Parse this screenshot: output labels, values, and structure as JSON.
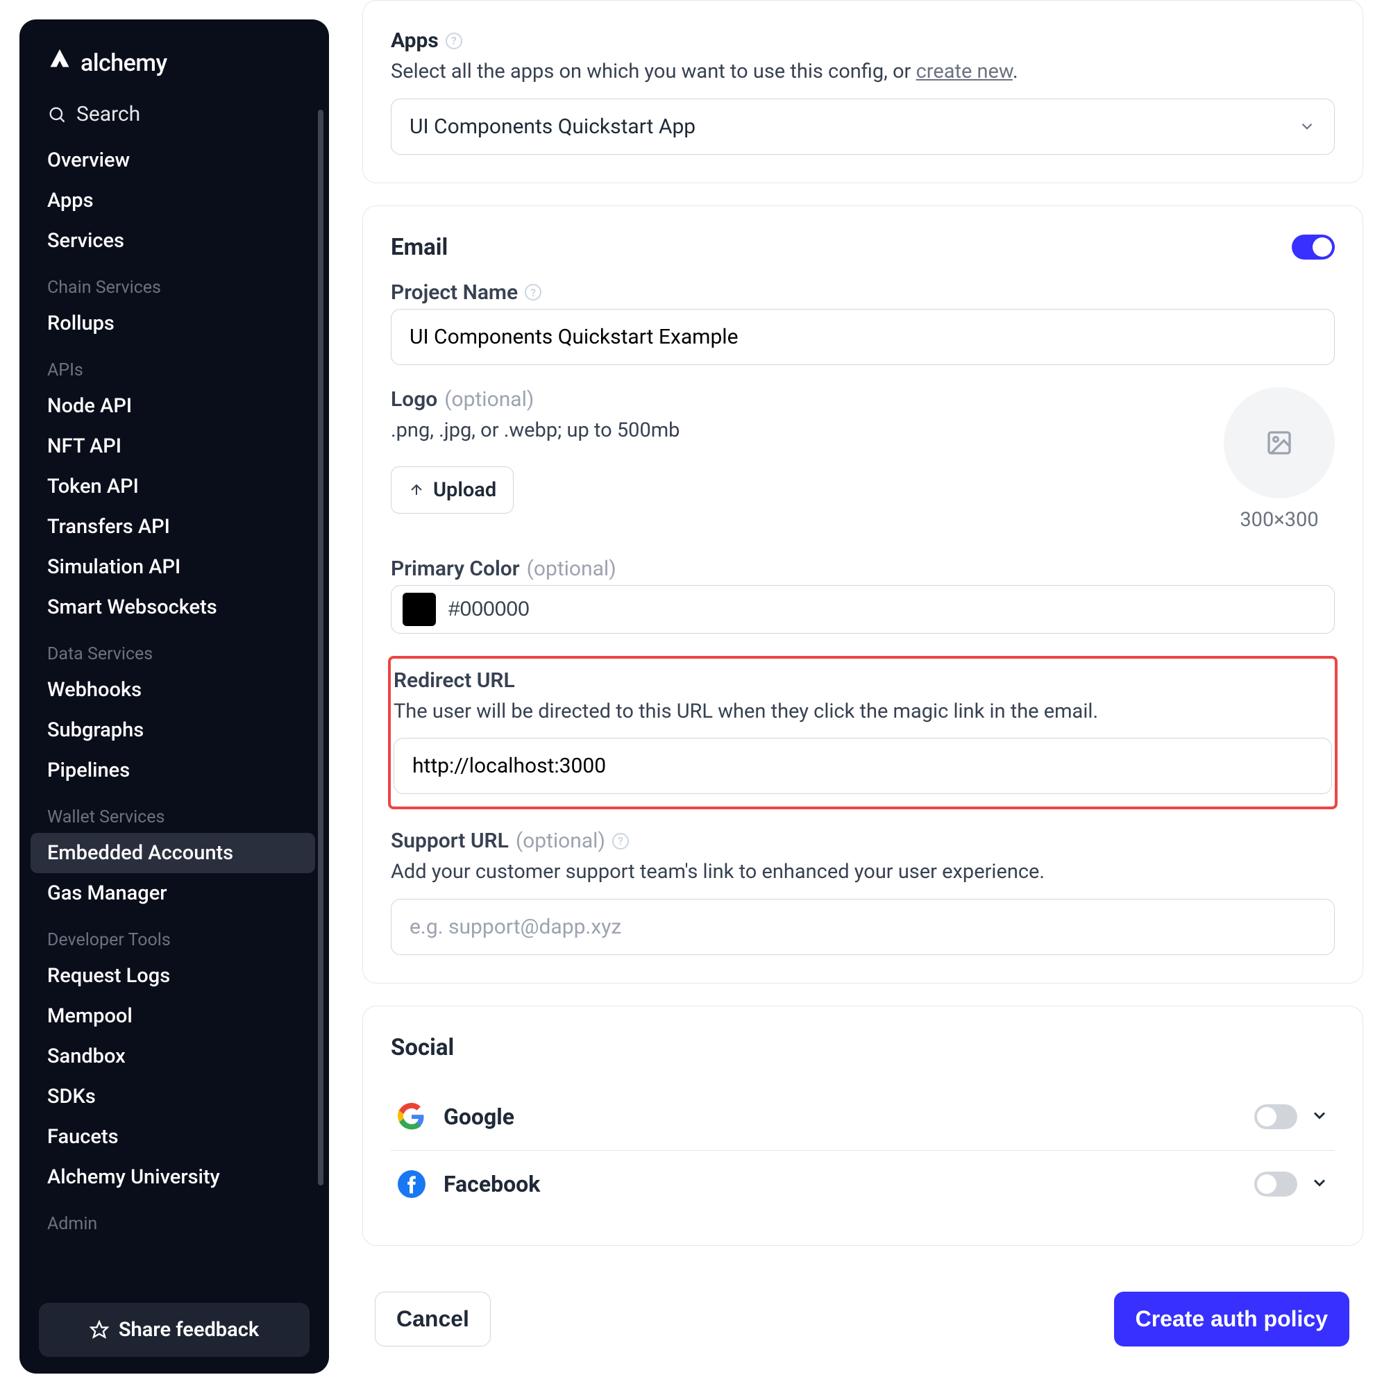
{
  "brand": "alchemy",
  "search_label": "Search",
  "sidebar": {
    "top": [
      "Overview",
      "Apps",
      "Services"
    ],
    "groups": [
      {
        "header": "Chain Services",
        "items": [
          "Rollups"
        ]
      },
      {
        "header": "APIs",
        "items": [
          "Node API",
          "NFT API",
          "Token API",
          "Transfers API",
          "Simulation API",
          "Smart Websockets"
        ]
      },
      {
        "header": "Data Services",
        "items": [
          "Webhooks",
          "Subgraphs",
          "Pipelines"
        ]
      },
      {
        "header": "Wallet Services",
        "items": [
          "Embedded Accounts",
          "Gas Manager"
        ]
      },
      {
        "header": "Developer Tools",
        "items": [
          "Request Logs",
          "Mempool",
          "Sandbox",
          "SDKs",
          "Faucets",
          "Alchemy University"
        ]
      },
      {
        "header": "Admin",
        "items": []
      }
    ],
    "active": "Embedded Accounts",
    "feedback": "Share feedback"
  },
  "apps_card": {
    "title": "Apps",
    "desc_prefix": "Select all the apps on which you want to use this config, or ",
    "create_new": "create new",
    "desc_suffix": ".",
    "selected": "UI Components Quickstart App"
  },
  "email_card": {
    "title": "Email",
    "enabled": true,
    "project_name_label": "Project Name",
    "project_name_value": "UI Components Quickstart Example",
    "logo_label": "Logo",
    "logo_hint": ".png, .jpg, or .webp; up to 500mb",
    "upload_label": "Upload",
    "logo_dims": "300×300",
    "primary_color_label": "Primary Color",
    "primary_color_hex": "#000000",
    "redirect_label": "Redirect URL",
    "redirect_desc": "The user will be directed to this URL when they click the magic link in the email.",
    "redirect_value": "http://localhost:3000",
    "support_label": "Support URL",
    "support_desc": "Add your customer support team's link to enhanced your user experience.",
    "support_placeholder": "e.g. support@dapp.xyz",
    "optional_text": "(optional)"
  },
  "social_card": {
    "title": "Social",
    "providers": [
      {
        "name": "Google",
        "enabled": false,
        "color": "#4285f4",
        "icon": "google"
      },
      {
        "name": "Facebook",
        "enabled": false,
        "color": "#1877f2",
        "icon": "facebook"
      }
    ]
  },
  "footer": {
    "cancel": "Cancel",
    "create": "Create auth policy"
  }
}
